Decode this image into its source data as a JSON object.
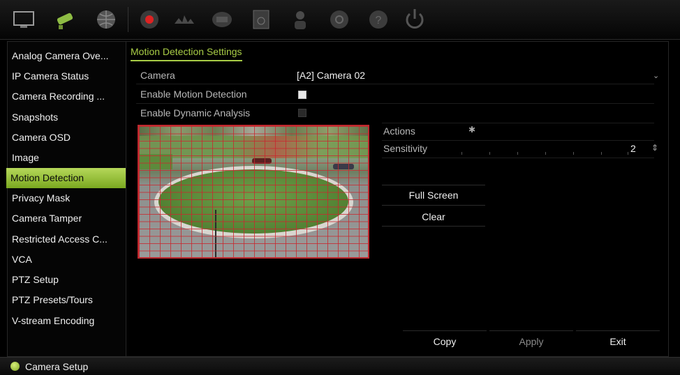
{
  "toolbar": {
    "icons": [
      "monitor-icon",
      "camera-icon",
      "network-icon",
      "recording-icon",
      "alarm-icon",
      "device-icon",
      "storage-icon",
      "user-icon",
      "system-icon",
      "help-icon",
      "power-icon"
    ]
  },
  "sidebar": {
    "items": [
      {
        "label": "Analog Camera Ove..."
      },
      {
        "label": "IP Camera Status"
      },
      {
        "label": "Camera Recording ..."
      },
      {
        "label": "Snapshots"
      },
      {
        "label": "Camera OSD"
      },
      {
        "label": "Image"
      },
      {
        "label": "Motion Detection"
      },
      {
        "label": "Privacy Mask"
      },
      {
        "label": "Camera Tamper"
      },
      {
        "label": "Restricted Access C..."
      },
      {
        "label": "VCA"
      },
      {
        "label": "PTZ Setup"
      },
      {
        "label": "PTZ Presets/Tours"
      },
      {
        "label": "V-stream Encoding"
      }
    ],
    "active_index": 6
  },
  "main": {
    "tab": "Motion Detection Settings",
    "camera_label": "Camera",
    "camera_value": "[A2] Camera 02",
    "enable_motion_label": "Enable Motion Detection",
    "enable_motion_checked": true,
    "enable_dynamic_label": "Enable Dynamic Analysis",
    "enable_dynamic_checked": false,
    "actions_label": "Actions",
    "sensitivity_label": "Sensitivity",
    "sensitivity_value": "2",
    "full_screen_label": "Full Screen",
    "clear_label": "Clear"
  },
  "footer": {
    "copy_label": "Copy",
    "apply_label": "Apply",
    "exit_label": "Exit"
  },
  "status": {
    "text": "Camera Setup"
  },
  "colors": {
    "accent": "#a9cd46",
    "grid": "#c0282e"
  }
}
